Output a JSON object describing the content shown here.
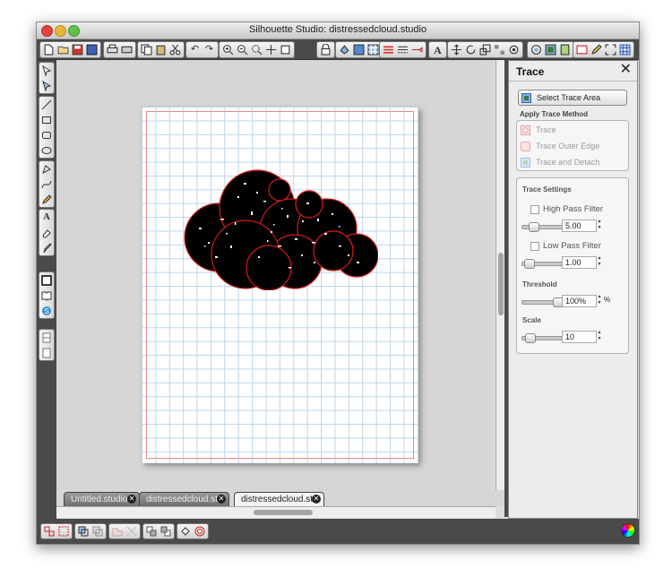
{
  "window": {
    "title": "Silhouette Studio: distressedcloud.studio"
  },
  "toolbar": {
    "groups": [
      {
        "name": "file",
        "icons": [
          "new-file-icon",
          "open-folder-icon",
          "save-icon",
          "library-icon"
        ]
      },
      {
        "name": "print",
        "icons": [
          "print-icon",
          "cut-settings-icon"
        ]
      },
      {
        "name": "clipboard",
        "icons": [
          "copy-icon",
          "paste-icon",
          "cut-scissors-icon"
        ]
      },
      {
        "name": "history",
        "icons": [
          "undo-icon",
          "redo-icon"
        ]
      },
      {
        "name": "zoom",
        "icons": [
          "zoom-in-icon",
          "zoom-out-icon",
          "zoom-select-icon",
          "pan-icon",
          "fit-page-icon"
        ]
      },
      {
        "name": "panels",
        "icons": [
          "store-icon",
          "fill-color-icon",
          "gradient-icon",
          "pattern-icon",
          "line-color-icon",
          "line-style-icon",
          "knife-icon",
          "text-style-icon",
          "transform-icon",
          "rotate-icon",
          "scale-icon",
          "replicate-icon",
          "modify-icon",
          "offset-icon",
          "trace-icon",
          "page-icon",
          "sketch-icon",
          "fullscreen-icon",
          "grid-icon"
        ]
      }
    ],
    "text_style_glyph": "A"
  },
  "left_tools": {
    "groups": [
      [
        "select-arrow-icon",
        "point-edit-icon"
      ],
      [
        "line-tool-icon",
        "rectangle-tool-icon",
        "rounded-rect-tool-icon",
        "ellipse-tool-icon"
      ],
      [
        "polygon-tool-icon",
        "curve-tool-icon",
        "freehand-tool-icon"
      ],
      [
        "text-tool-icon",
        "eraser-tool-icon",
        "knife-tool-icon"
      ],
      [
        "page-setup-icon",
        "library-book-icon",
        "silhouette-store-icon"
      ],
      [
        "panel-split-top-icon",
        "panel-split-bottom-icon"
      ]
    ],
    "text_glyph": "A"
  },
  "tabs": [
    {
      "label": "Untitled.studio",
      "active": false
    },
    {
      "label": "distressedcloud.st...",
      "active": false
    },
    {
      "label": "distressedcloud.st...",
      "active": true
    }
  ],
  "bottom_tools": {
    "groups": [
      [
        "group-icon",
        "ungroup-icon"
      ],
      [
        "compound-path-icon",
        "release-compound-icon"
      ],
      [
        "weld-icon",
        "subdivide-icon"
      ],
      [
        "bring-front-icon",
        "send-back-icon"
      ],
      [
        "fill-bucket-icon",
        "registration-mark-icon"
      ]
    ]
  },
  "trace_panel": {
    "title": "Trace",
    "close_label": "✕",
    "select_area_label": "Select Trace Area",
    "apply_method_heading": "Apply Trace Method",
    "methods": [
      {
        "label": "Trace",
        "icon": "trace-method-icon"
      },
      {
        "label": "Trace Outer Edge",
        "icon": "trace-outer-edge-icon"
      },
      {
        "label": "Trace and Detach",
        "icon": "trace-detach-icon"
      }
    ],
    "settings_heading": "Trace Settings",
    "high_pass": {
      "label": "High Pass Filter",
      "checked": false,
      "value": "5.00",
      "level": 0.2
    },
    "low_pass": {
      "label": "Low Pass Filter",
      "checked": false,
      "value": "1.00",
      "level": 0.05
    },
    "threshold": {
      "label": "Threshold",
      "value": "100%",
      "unit": "%",
      "level": 1.0
    },
    "scale": {
      "label": "Scale",
      "value": "10",
      "level": 0.1
    }
  },
  "colors": {
    "toolbar_dark": "#4a4a4a",
    "grid_line": "#bcd6ea",
    "page_margin": "#e88a8a",
    "cloud_fill": "#000000",
    "cloud_outline": "#d41c1c"
  }
}
